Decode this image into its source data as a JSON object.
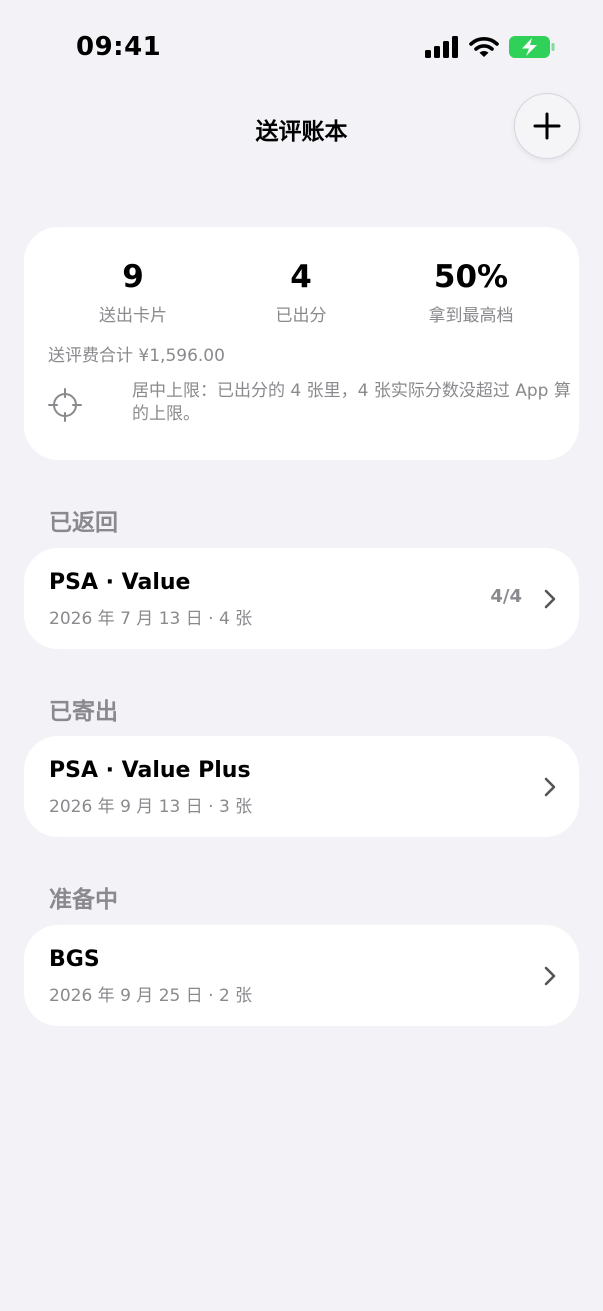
{
  "status_bar": {
    "time": "09:41",
    "icons": [
      "cellular-signal-icon",
      "wifi-icon",
      "battery-charging-icon"
    ],
    "battery_color": "#30d158"
  },
  "header": {
    "title": "送评账本",
    "add_icon": "plus-icon"
  },
  "summary": {
    "stats": [
      {
        "value": "9",
        "label": "送出卡片"
      },
      {
        "value": "4",
        "label": "已出分"
      },
      {
        "value": "50%",
        "label": "拿到最高档"
      }
    ],
    "fee_total": "送评费合计 ¥1,596.00",
    "note_icon": "crosshair-icon",
    "note": "居中上限：已出分的 4 张里，4 张实际分数没超过 App 算的上限。"
  },
  "sections": [
    {
      "title": "已返回",
      "items": [
        {
          "title": "PSA · Value",
          "subtitle": "2026 年 7 月 13 日 · 4 张",
          "count": "4/4"
        }
      ]
    },
    {
      "title": "已寄出",
      "items": [
        {
          "title": "PSA · Value Plus",
          "subtitle": "2026 年 9 月 13 日 · 3 张",
          "count": ""
        }
      ]
    },
    {
      "title": "准备中",
      "items": [
        {
          "title": "BGS",
          "subtitle": "2026 年 9 月 25 日 · 2 张",
          "count": ""
        }
      ]
    }
  ],
  "colors": {
    "background": "#f2f2f7",
    "card": "#ffffff",
    "secondary_text": "#8a8a8e"
  }
}
